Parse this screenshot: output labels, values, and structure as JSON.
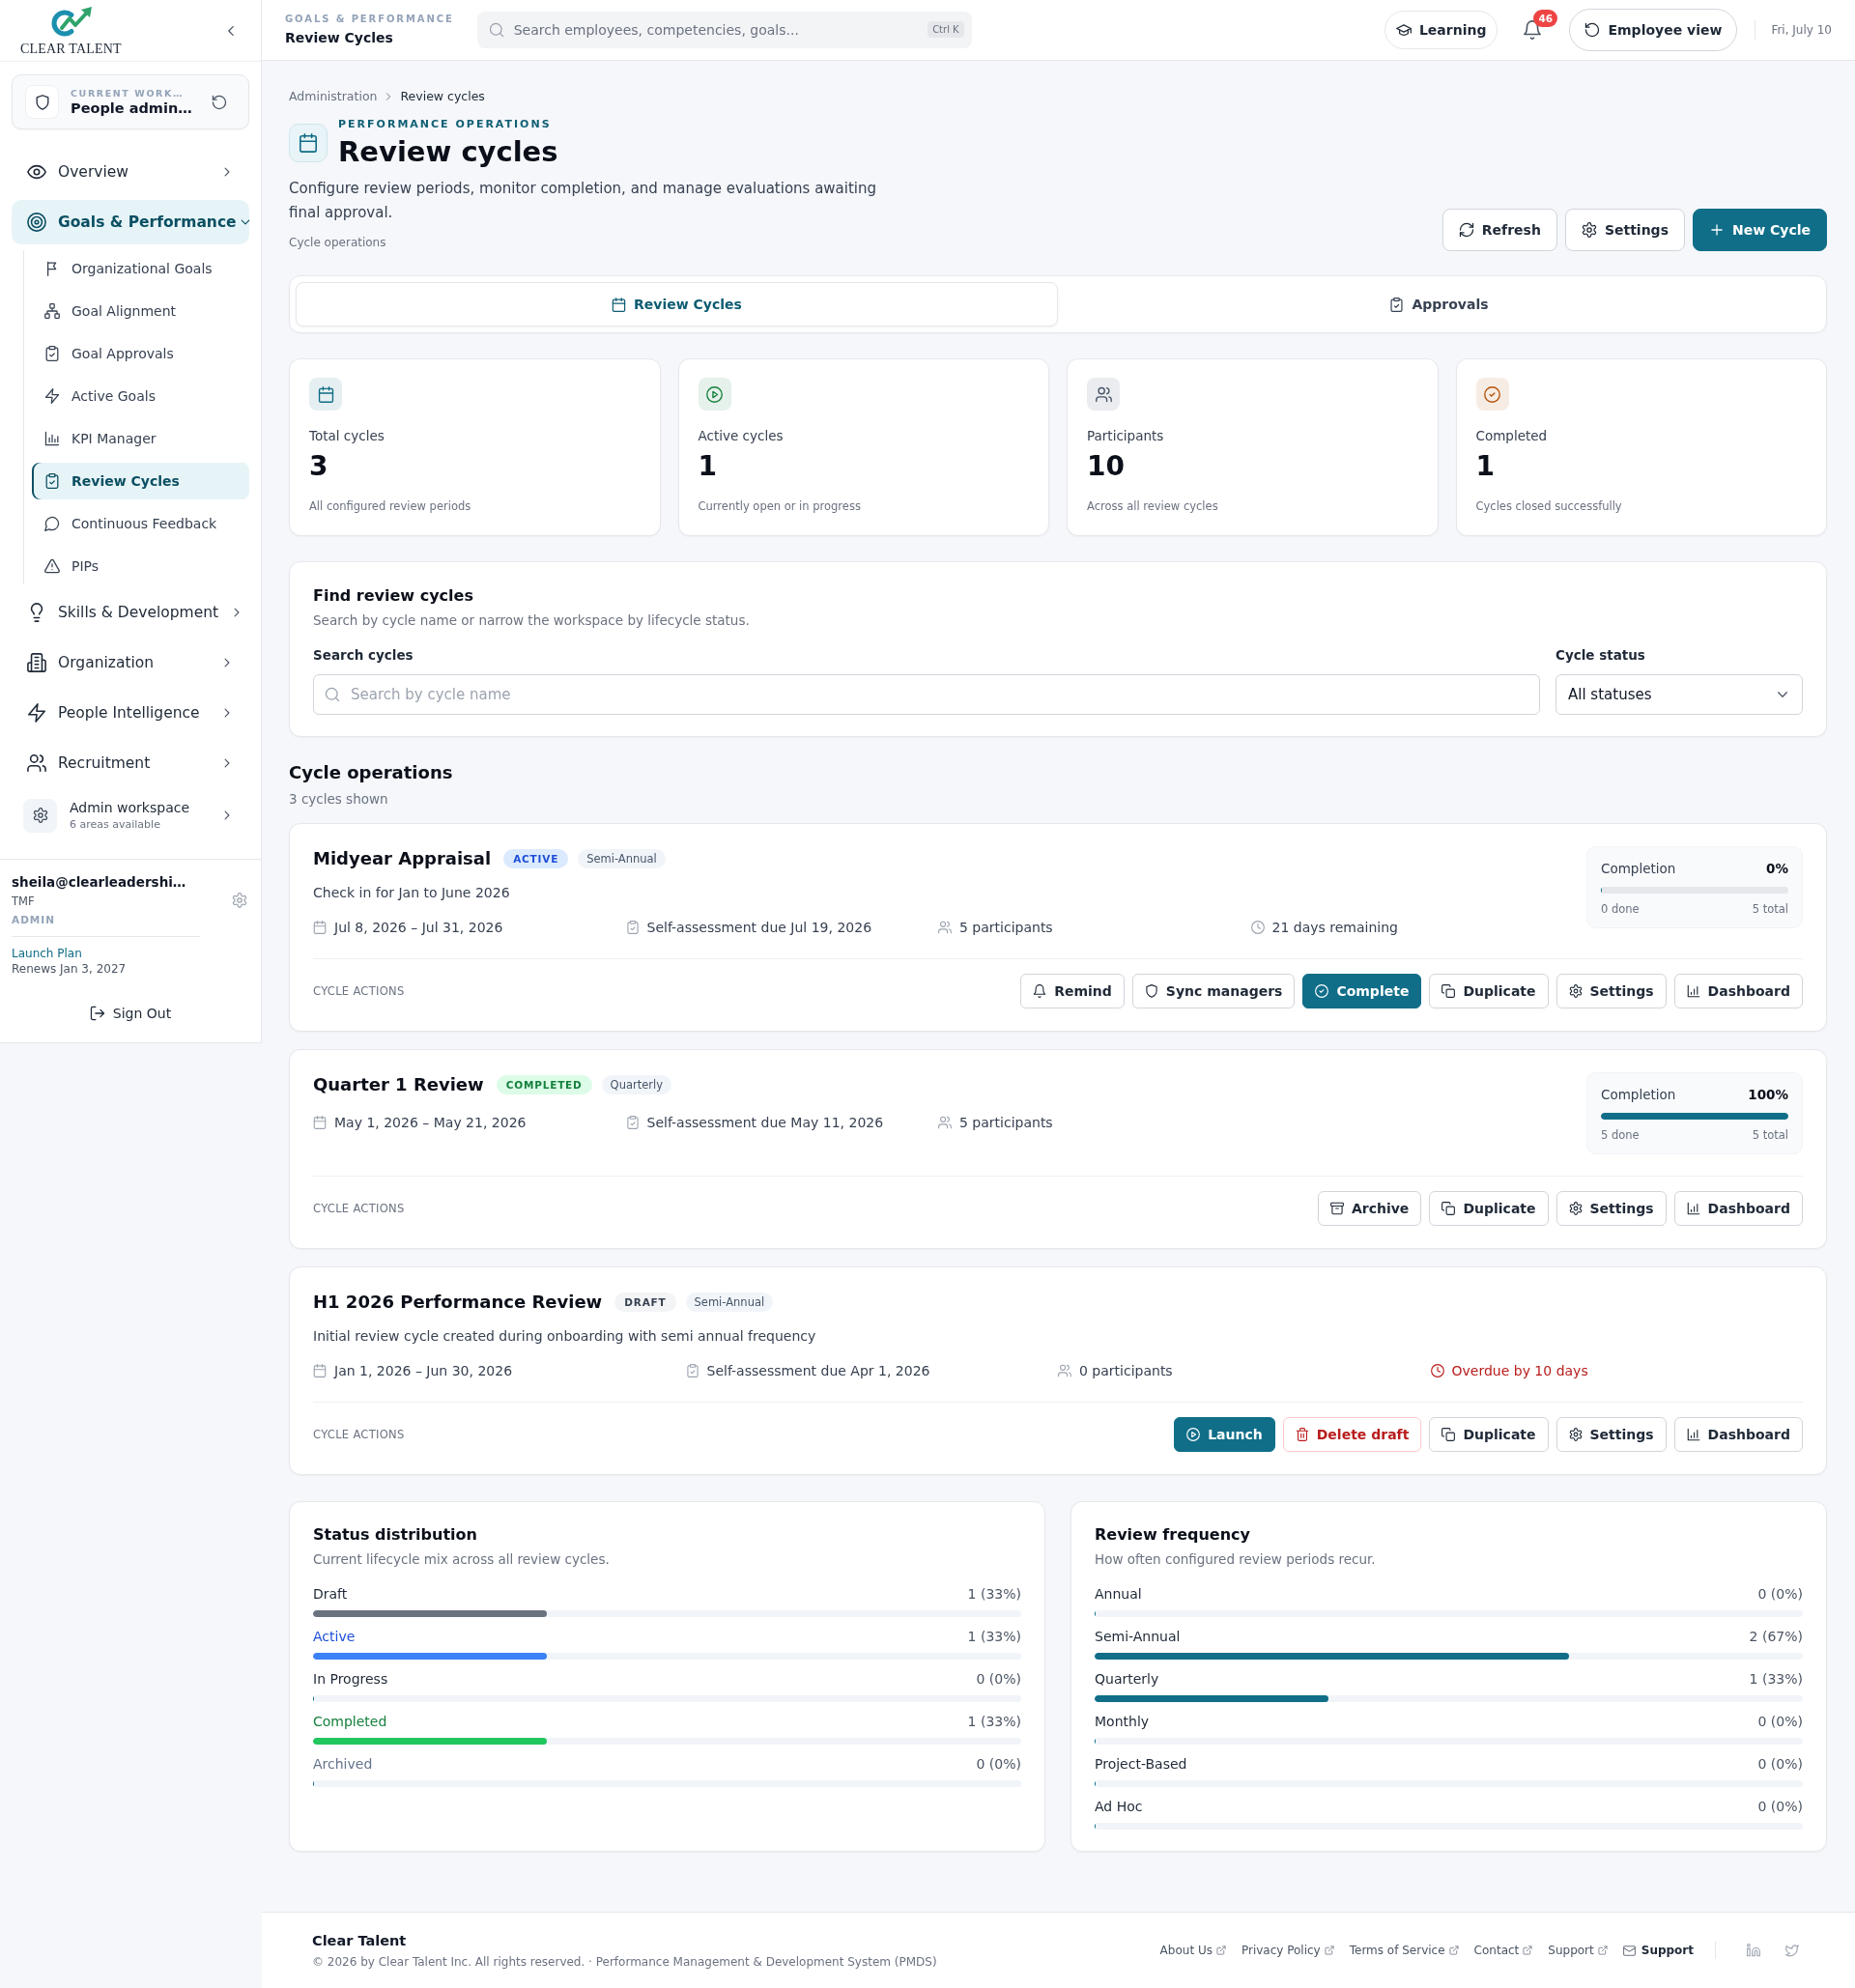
{
  "sidebar": {
    "logo_text": "CLEAR TALENT",
    "workspace": {
      "caption": "CURRENT WORK…",
      "name": "People admin…"
    },
    "nav": [
      {
        "label": "Overview",
        "selected": false,
        "expanded": false
      },
      {
        "label": "Goals & Performance",
        "selected": true,
        "expanded": true,
        "children": [
          {
            "label": "Organizational Goals",
            "selected": false
          },
          {
            "label": "Goal Alignment",
            "selected": false
          },
          {
            "label": "Goal Approvals",
            "selected": false
          },
          {
            "label": "Active Goals",
            "selected": false
          },
          {
            "label": "KPI Manager",
            "selected": false
          },
          {
            "label": "Review Cycles",
            "selected": true
          },
          {
            "label": "Continuous Feedback",
            "selected": false
          },
          {
            "label": "PIPs",
            "selected": false
          }
        ]
      },
      {
        "label": "Skills & Development",
        "selected": false,
        "expanded": false
      },
      {
        "label": "Organization",
        "selected": false,
        "expanded": false
      },
      {
        "label": "People Intelligence",
        "selected": false,
        "expanded": false
      },
      {
        "label": "Recruitment",
        "selected": false,
        "expanded": false
      }
    ],
    "admin": {
      "label": "Admin workspace",
      "caption": "6 areas available"
    },
    "user": {
      "email": "sheila@clearleadershi…",
      "org": "TMF",
      "role": "ADMIN",
      "plan": "Launch Plan",
      "renewal": "Renews Jan 3, 2027"
    },
    "sign_out": "Sign Out"
  },
  "topbar": {
    "section": "GOALS & PERFORMANCE",
    "page": "Review Cycles",
    "search": {
      "placeholder": "Search employees, competencies, goals...",
      "shortcut": "Ctrl K"
    },
    "learning": "Learning",
    "notifications": "46",
    "employee_view": "Employee view",
    "date": "Fri, July 10"
  },
  "page_header": {
    "breadcrumb": [
      "Administration",
      "Review cycles"
    ],
    "eyebrow": "PERFORMANCE OPERATIONS",
    "title": "Review cycles",
    "description": "Configure review periods, monitor completion, and manage evaluations awaiting final approval.",
    "caption": "Cycle operations",
    "actions": [
      {
        "label": "Refresh",
        "kind": "refresh"
      },
      {
        "label": "Settings",
        "kind": "settings"
      },
      {
        "label": "New Cycle",
        "kind": "create"
      }
    ]
  },
  "tabs": [
    {
      "label": "Review Cycles",
      "selected": true
    },
    {
      "label": "Approvals",
      "selected": false
    }
  ],
  "stats": [
    {
      "label": "Total cycles",
      "value": "3",
      "caption": "All configured review periods",
      "color": "#0f6b85"
    },
    {
      "label": "Active cycles",
      "value": "1",
      "caption": "Currently open or in progress",
      "color": "#15803d"
    },
    {
      "label": "Participants",
      "value": "10",
      "caption": "Across all review cycles",
      "color": "#475569"
    },
    {
      "label": "Completed",
      "value": "1",
      "caption": "Cycles closed successfully",
      "color": "#b45309"
    }
  ],
  "filters": {
    "title": "Find review cycles",
    "subtitle": "Search by cycle name or narrow the workspace by lifecycle status.",
    "search": {
      "label": "Search cycles",
      "placeholder": "Search by cycle name"
    },
    "status": {
      "label": "Cycle status",
      "value": "All statuses"
    }
  },
  "cycles": {
    "title": "Cycle operations",
    "count": "3 cycles shown",
    "items": [
      {
        "name": "Midyear Appraisal",
        "status": {
          "label": "ACTIVE",
          "kind": "active"
        },
        "frequency": "Semi-Annual",
        "description": "Check in for Jan to June 2026",
        "meta": [
          {
            "kind": "dates",
            "text": "Jul 8, 2026 – Jul 31, 2026"
          },
          {
            "kind": "due",
            "text": "Self-assessment due Jul 19, 2026"
          },
          {
            "kind": "participants",
            "text": "5 participants"
          },
          {
            "kind": "remaining",
            "text": "21 days remaining"
          }
        ],
        "completion": {
          "label": "Completion",
          "value": "0%",
          "level": 0,
          "done": "0 done",
          "total": "5 total"
        },
        "actions_label": "CYCLE ACTIONS",
        "actions": [
          {
            "label": "Remind",
            "kind": "remind"
          },
          {
            "label": "Sync managers",
            "kind": "sync"
          },
          {
            "label": "Complete",
            "kind": "complete"
          },
          {
            "label": "Duplicate",
            "kind": "duplicate"
          },
          {
            "label": "Settings",
            "kind": "settings"
          },
          {
            "label": "Dashboard",
            "kind": "dashboard"
          }
        ]
      },
      {
        "name": "Quarter 1 Review",
        "status": {
          "label": "COMPLETED",
          "kind": "completed"
        },
        "frequency": "Quarterly",
        "meta": [
          {
            "kind": "dates",
            "text": "May 1, 2026 – May 21, 2026"
          },
          {
            "kind": "due",
            "text": "Self-assessment due May 11, 2026"
          },
          {
            "kind": "participants",
            "text": "5 participants"
          }
        ],
        "completion": {
          "label": "Completion",
          "value": "100%",
          "level": 1,
          "done": "5 done",
          "total": "5 total"
        },
        "actions_label": "CYCLE ACTIONS",
        "actions": [
          {
            "label": "Archive",
            "kind": "archive"
          },
          {
            "label": "Duplicate",
            "kind": "duplicate"
          },
          {
            "label": "Settings",
            "kind": "settings"
          },
          {
            "label": "Dashboard",
            "kind": "dashboard"
          }
        ]
      },
      {
        "name": "H1 2026 Performance Review",
        "status": {
          "label": "DRAFT",
          "kind": "draft"
        },
        "frequency": "Semi-Annual",
        "description": "Initial review cycle created during onboarding with semi annual frequency",
        "meta": [
          {
            "kind": "dates",
            "text": "Jan 1, 2026 – Jun 30, 2026"
          },
          {
            "kind": "due",
            "text": "Self-assessment due Apr 1, 2026"
          },
          {
            "kind": "participants",
            "text": "0 participants"
          },
          {
            "kind": "overdue",
            "text": "Overdue by 10 days"
          }
        ],
        "actions_label": "CYCLE ACTIONS",
        "actions": [
          {
            "label": "Launch",
            "kind": "launch"
          },
          {
            "label": "Delete draft",
            "kind": "delete"
          },
          {
            "label": "Duplicate",
            "kind": "duplicate"
          },
          {
            "label": "Settings",
            "kind": "settings"
          },
          {
            "label": "Dashboard",
            "kind": "dashboard"
          }
        ]
      }
    ]
  },
  "status_distribution": {
    "title": "Status distribution",
    "subtitle": "Current lifecycle mix across all review cycles.",
    "rows": [
      {
        "label": "Draft",
        "kind": "draft",
        "value": "1 (33%)",
        "level": 0.33,
        "color": "#6b7280"
      },
      {
        "label": "Active",
        "kind": "active",
        "value": "1 (33%)",
        "level": 0.33,
        "color": "#3b82f6"
      },
      {
        "label": "In Progress",
        "kind": "progress",
        "value": "0 (0%)",
        "level": 0
      },
      {
        "label": "Completed",
        "kind": "completed",
        "value": "1 (33%)",
        "level": 0.33,
        "color": "#22c55e"
      },
      {
        "label": "Archived",
        "kind": "archived",
        "value": "0 (0%)",
        "level": 0
      }
    ]
  },
  "review_frequency": {
    "title": "Review frequency",
    "subtitle": "How often configured review periods recur.",
    "rows": [
      {
        "label": "Annual",
        "value": "0 (0%)",
        "level": 0
      },
      {
        "label": "Semi-Annual",
        "value": "2 (67%)",
        "level": 0.67
      },
      {
        "label": "Quarterly",
        "value": "1 (33%)",
        "level": 0.33
      },
      {
        "label": "Monthly",
        "value": "0 (0%)",
        "level": 0
      },
      {
        "label": "Project-Based",
        "value": "0 (0%)",
        "level": 0
      },
      {
        "label": "Ad Hoc",
        "value": "0 (0%)",
        "level": 0
      }
    ]
  },
  "footer": {
    "brand": "Clear Talent",
    "copyright": "© 2026 by Clear Talent Inc. All rights reserved. · Performance Management & Development System (PMDS)",
    "links": [
      {
        "label": "About Us",
        "kind": "external"
      },
      {
        "label": "Privacy Policy",
        "kind": "external"
      },
      {
        "label": "Terms of Service",
        "kind": "external"
      },
      {
        "label": "Contact",
        "kind": "external"
      },
      {
        "label": "Support",
        "kind": "external"
      },
      {
        "label": "Support",
        "kind": "email"
      }
    ]
  }
}
